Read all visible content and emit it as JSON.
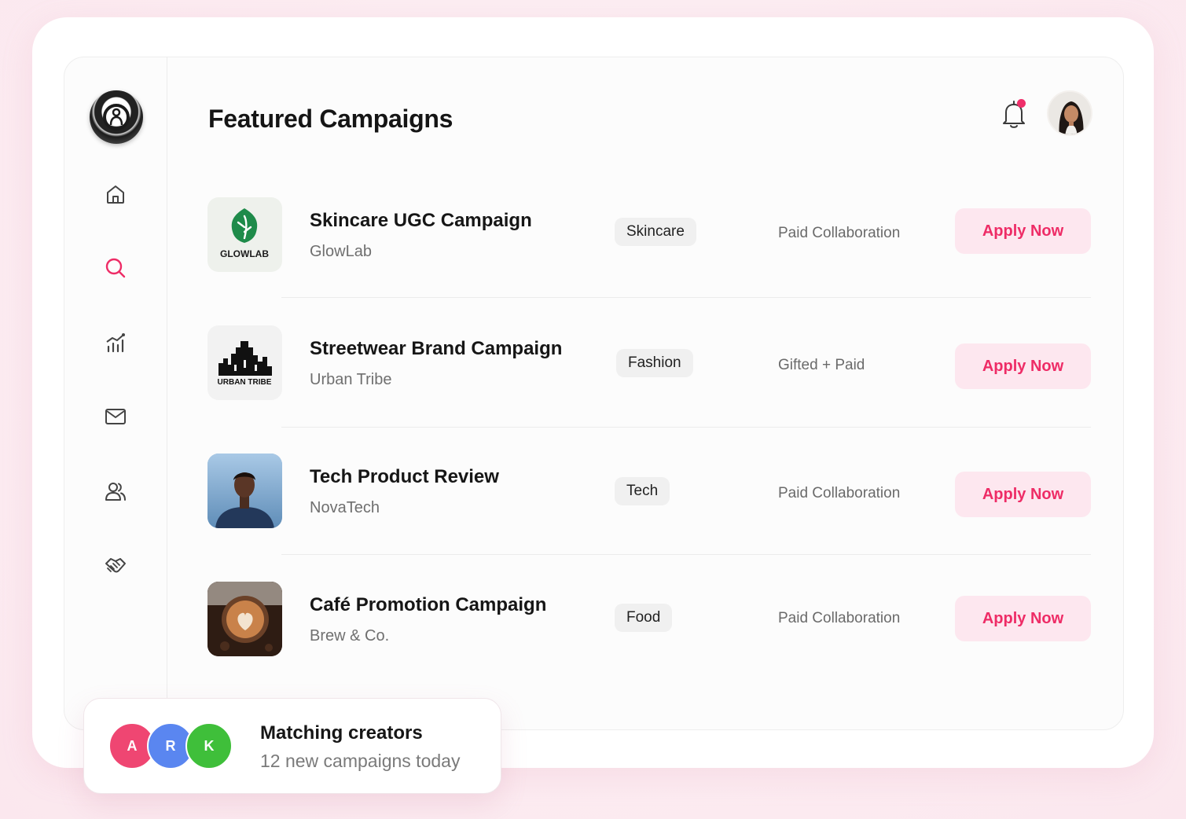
{
  "header": {
    "title": "Featured Campaigns"
  },
  "sidebar": {
    "items": [
      {
        "icon": "home-icon"
      },
      {
        "icon": "search-icon",
        "active": true
      },
      {
        "icon": "analytics-icon"
      },
      {
        "icon": "mail-icon"
      },
      {
        "icon": "users-icon"
      },
      {
        "icon": "handshake-icon"
      }
    ]
  },
  "campaigns": [
    {
      "title": "Skincare UGC Campaign",
      "brand": "GlowLab",
      "logo_text": "GLOWLAB",
      "tag": "Skincare",
      "collab": "Paid Collaboration",
      "cta": "Apply Now"
    },
    {
      "title": "Streetwear Brand Campaign",
      "brand": "Urban Tribe",
      "logo_text": "URBAN TRIBE",
      "tag": "Fashion",
      "collab": "Gifted + Paid",
      "cta": "Apply Now"
    },
    {
      "title": "Tech Product Review",
      "brand": "NovaTech",
      "tag": "Tech",
      "collab": "Paid Collaboration",
      "cta": "Apply Now"
    },
    {
      "title": "Café Promotion Campaign",
      "brand": "Brew & Co.",
      "tag": "Food",
      "collab": "Paid Collaboration",
      "cta": "Apply Now"
    }
  ],
  "matching": {
    "title": "Matching creators",
    "subtitle": "12 new campaigns today",
    "avatars": [
      {
        "initial": "A",
        "color": "#ef4672"
      },
      {
        "initial": "R",
        "color": "#5a86f0"
      },
      {
        "initial": "K",
        "color": "#3fbf3a"
      }
    ]
  },
  "colors": {
    "accent": "#ee2c66",
    "accent_bg": "#fde7ef",
    "notification_dot": "#ef2f6a"
  }
}
